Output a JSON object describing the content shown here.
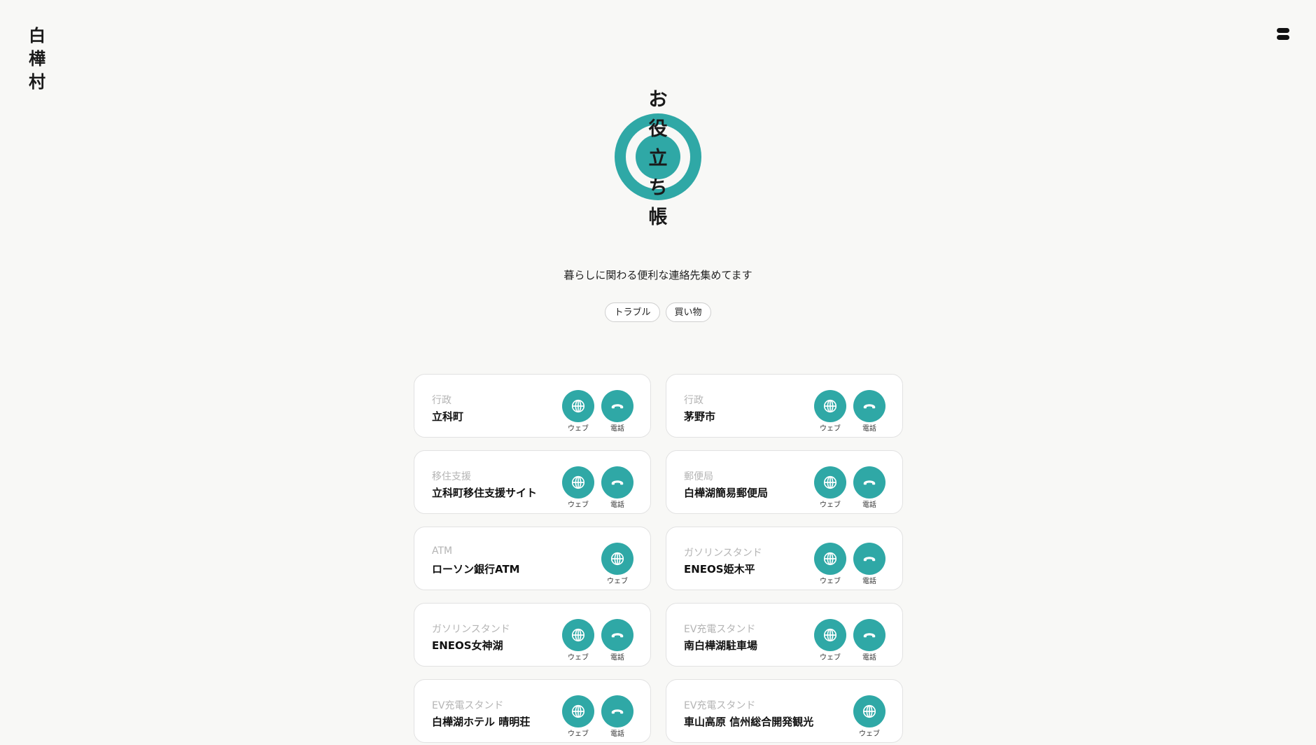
{
  "brand": {
    "chars": [
      "白",
      "樺",
      "村"
    ]
  },
  "hero": {
    "title_chars": [
      "お",
      "役",
      "立",
      "ち",
      "帳"
    ],
    "tagline": "暮らしに関わる便利な連絡先集めてます",
    "accent_color": "#2fa8a6"
  },
  "filters": [
    {
      "label": "トラブル"
    },
    {
      "label": "買い物"
    }
  ],
  "labels": {
    "web": "ウェブ",
    "phone": "電話"
  },
  "cards": [
    {
      "category": "行政",
      "name": "立科町",
      "web": true,
      "phone": true
    },
    {
      "category": "行政",
      "name": "茅野市",
      "web": true,
      "phone": true
    },
    {
      "category": "移住支援",
      "name": "立科町移住支援サイト",
      "web": true,
      "phone": true
    },
    {
      "category": "郵便局",
      "name": "白樺湖簡易郵便局",
      "web": true,
      "phone": true
    },
    {
      "category": "ATM",
      "name": "ローソン銀行ATM",
      "web": true,
      "phone": false
    },
    {
      "category": "ガソリンスタンド",
      "name": "ENEOS姫木平",
      "web": true,
      "phone": true
    },
    {
      "category": "ガソリンスタンド",
      "name": "ENEOS女神湖",
      "web": true,
      "phone": true
    },
    {
      "category": "EV充電スタンド",
      "name": "南白樺湖駐車場",
      "web": true,
      "phone": true
    },
    {
      "category": "EV充電スタンド",
      "name": "白樺湖ホテル 晴明荘",
      "web": true,
      "phone": true
    },
    {
      "category": "EV充電スタンド",
      "name": "車山高原 信州総合開発観光",
      "web": true,
      "phone": false
    }
  ]
}
